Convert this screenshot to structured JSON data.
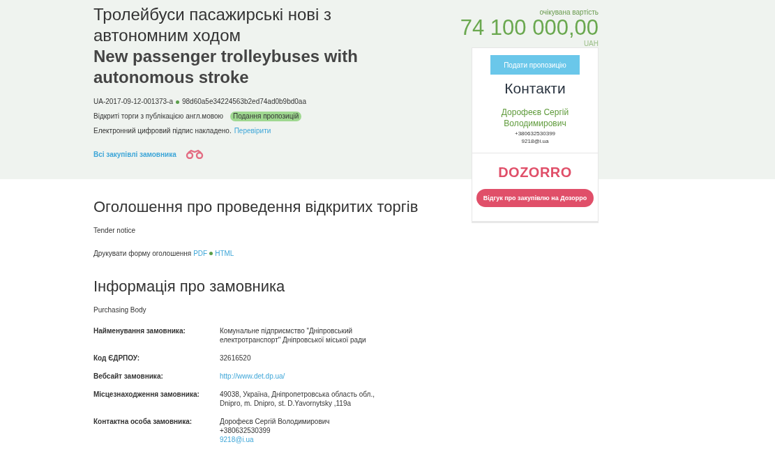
{
  "header": {
    "title_uk": "Тролейбуси пасажирські нові з автономним ходом",
    "title_en": "New passenger trolleybuses with autonomous stroke",
    "tender_id": "UA-2017-09-12-001373-a",
    "hash": "98d60a5e34224563b2ed74ad0b9bd0aa",
    "procedure": "Відкриті торги з публікацією англ.мовою",
    "status": "Подання пропозицій",
    "signature": "Електронний цифровий підпис накладено.",
    "verify_link": "Перевірити",
    "all_purchases_link": "Всі закупівлі замовника"
  },
  "price": {
    "label": "очікувана вартість",
    "amount": "74 100 000,00",
    "currency": "UAH"
  },
  "sidebar": {
    "submit_button": "Подати пропозицію",
    "contacts_title": "Контакти",
    "contact_name": "Дорофеєв Сергій Володимирович",
    "phone": "+380632530399",
    "email": "9218@i.ua",
    "dozorro_logo": "DOZORRO",
    "dozorro_button": "Відгук про закупівлю на Дозорро"
  },
  "notice": {
    "title": "Оголошення про проведення відкритих торгів",
    "subtitle": "Tender notice",
    "print_label": "Друкувати форму оголошення",
    "pdf_link": "PDF",
    "html_link": "HTML"
  },
  "buyer": {
    "title": "Інформація про замовника",
    "subtitle": "Purchasing Body",
    "rows": [
      {
        "label": "Найменування замовника:",
        "lines": [
          {
            "text": "Комунальне підприємство \"Дніпровський електротранспорт\" Дніпровської міської ради",
            "link": false
          }
        ]
      },
      {
        "label": "Код ЄДРПОУ:",
        "lines": [
          {
            "text": "32616520",
            "link": false
          }
        ]
      },
      {
        "label": "Вебсайт замовника:",
        "lines": [
          {
            "text": "http://www.det.dp.ua/",
            "link": true
          }
        ]
      },
      {
        "label": "Місцезнаходження замовника:",
        "lines": [
          {
            "text": "49038, Україна, Дніпропетровська область обл., Dnipro, m. Dnipro, st. D.Yavornytsky ,119a",
            "link": false
          }
        ]
      },
      {
        "label": "Контактна особа замовника:",
        "lines": [
          {
            "text": "Дорофеєв Сергій Володимирович",
            "link": false
          },
          {
            "text": "+380632530399",
            "link": false
          },
          {
            "text": "9218@i.ua",
            "link": true
          }
        ]
      }
    ]
  }
}
